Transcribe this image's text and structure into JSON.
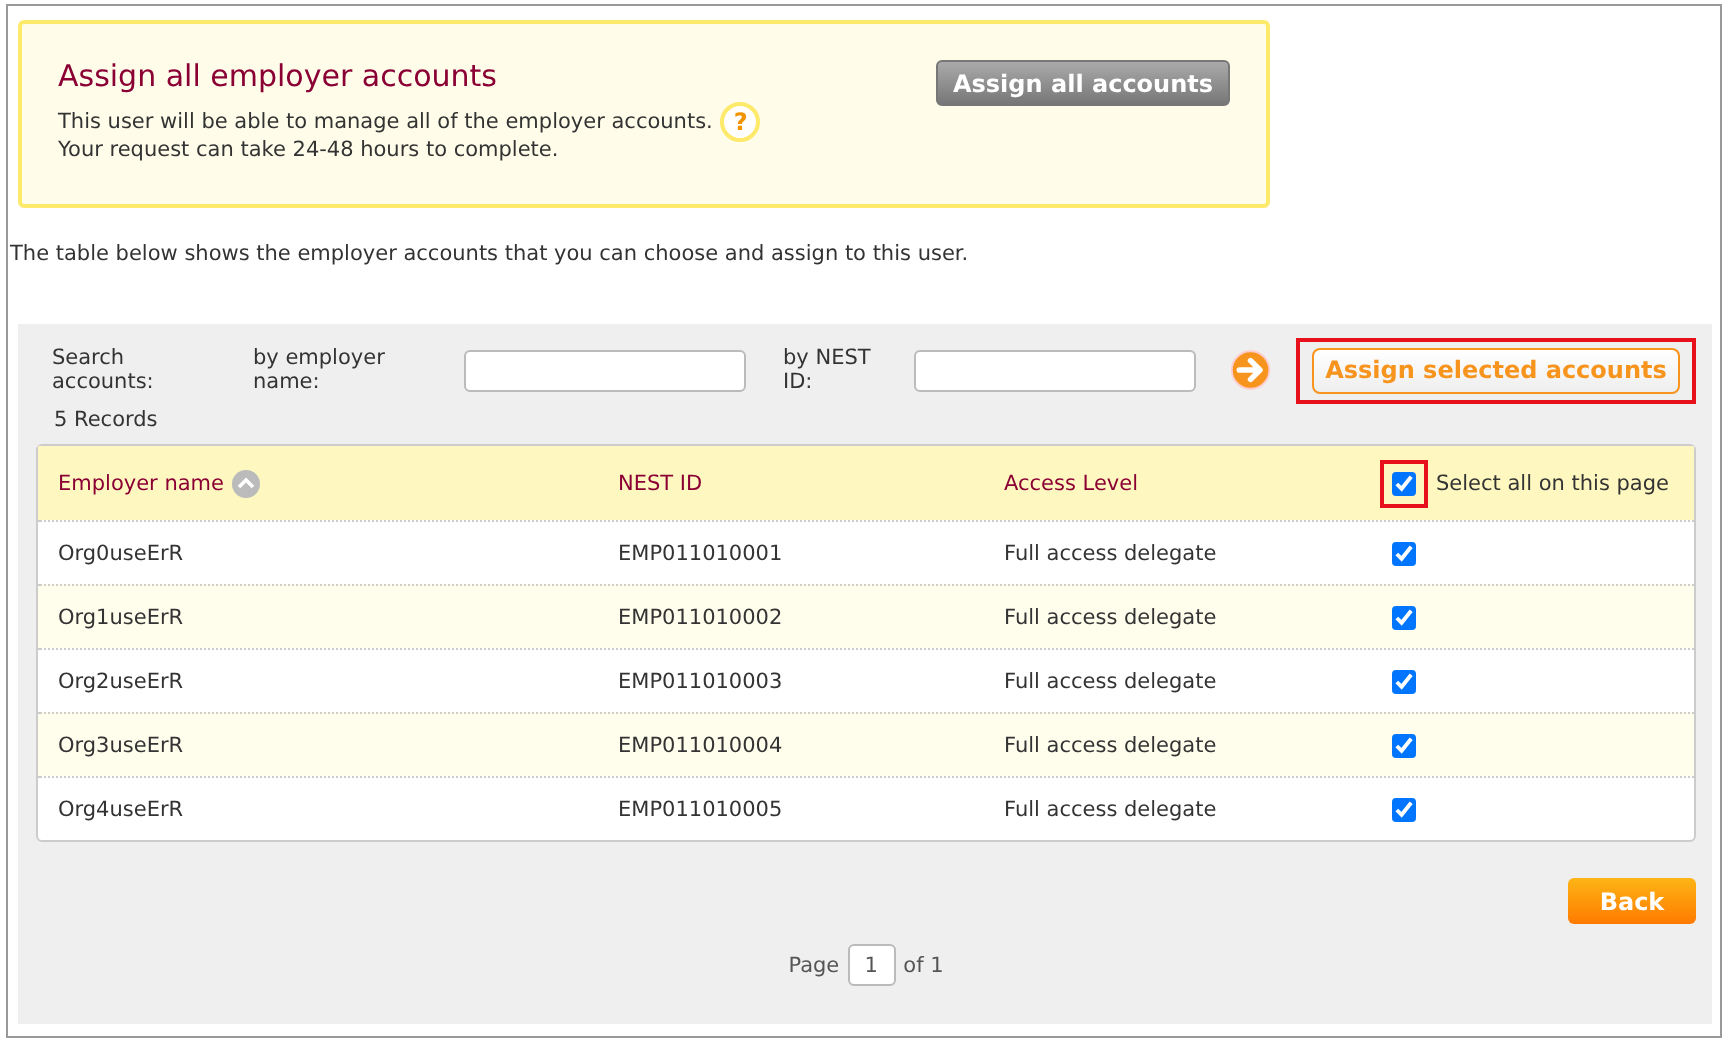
{
  "assign_all": {
    "title": "Assign all employer accounts",
    "description": "This user will be able to manage all of the employer accounts.",
    "note": "Your request can take 24-48 hours to complete.",
    "help_icon": "?",
    "button": "Assign all accounts"
  },
  "intro": "The table below shows the employer accounts that you can choose and assign to this user.",
  "search": {
    "label": "Search accounts:",
    "employer_label": "by employer name:",
    "nest_label": "by NEST ID:",
    "button": "Assign selected accounts",
    "highlighted": true
  },
  "records": "5 Records",
  "table": {
    "columns": [
      "Employer name",
      "NEST ID",
      "Access Level"
    ],
    "select_all": {
      "label": "Select all on this page",
      "checked": true,
      "highlighted": true
    },
    "rows": [
      {
        "name": "Org0useErR",
        "nest_id": "EMP011010001",
        "access": "Full access delegate",
        "checked": true
      },
      {
        "name": "Org1useErR",
        "nest_id": "EMP011010002",
        "access": "Full access delegate",
        "checked": true
      },
      {
        "name": "Org2useErR",
        "nest_id": "EMP011010003",
        "access": "Full access delegate",
        "checked": true
      },
      {
        "name": "Org3useErR",
        "nest_id": "EMP011010004",
        "access": "Full access delegate",
        "checked": true
      },
      {
        "name": "Org4useErR",
        "nest_id": "EMP011010005",
        "access": "Full access delegate",
        "checked": true
      }
    ]
  },
  "back_button": "Back",
  "pagination": {
    "label": "Page",
    "page": "1",
    "of": "of 1"
  }
}
